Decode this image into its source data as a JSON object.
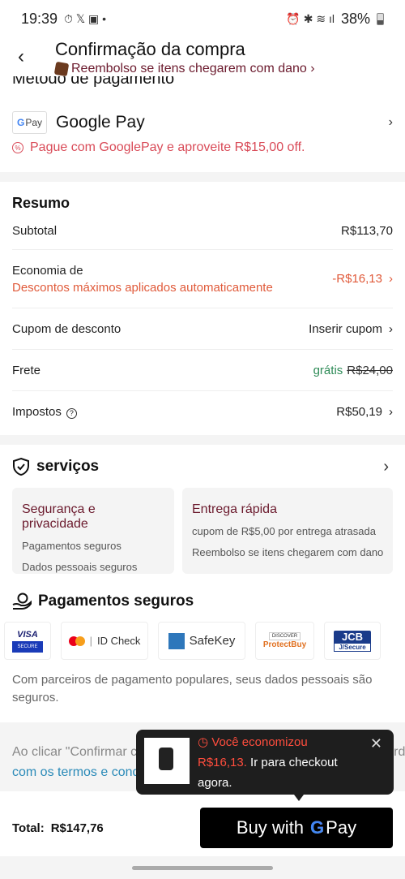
{
  "status_bar": {
    "time": "19:39",
    "battery": "38%",
    "battery_level": 0.38
  },
  "header": {
    "title": "Confirmação da compra",
    "subtitle": "Reembolso se itens chegarem com dano ›"
  },
  "payment_method": {
    "section_title": "Método de pagamento",
    "logo_text": "Pay",
    "name": "Google Pay",
    "promo": "Pague com GooglePay e aproveite R$15,00 off."
  },
  "summary": {
    "title": "Resumo",
    "subtotal_label": "Subtotal",
    "subtotal_value": "R$113,70",
    "savings_label": "Economia de",
    "savings_note": "Descontos máximos aplicados automaticamente",
    "savings_value": "-R$16,13",
    "coupon_label": "Cupom de desconto",
    "coupon_value": "Inserir cupom",
    "shipping_label": "Frete",
    "shipping_free": "grátis",
    "shipping_original": "R$24,00",
    "taxes_label": "Impostos",
    "taxes_value": "R$50,19"
  },
  "services": {
    "title": "serviços",
    "cards": [
      {
        "title": "Segurança e privacidade",
        "lines": [
          "Pagamentos seguros",
          "Dados pessoais seguros"
        ]
      },
      {
        "title": "Entrega rápida",
        "lines": [
          "cupom de R$5,00 por entrega atrasada",
          "Reembolso se itens chegarem com dano"
        ]
      }
    ]
  },
  "secure_payments": {
    "title": "Pagamentos seguros",
    "logos": [
      "VISA SECURE",
      "ID Check",
      "SafeKey",
      "ProtectBuy",
      "JCB J/Secure"
    ],
    "note": "Com parceiros de pagamento populares, seus dados pessoais são seguros."
  },
  "terms": {
    "line1": "Ao clicar \"Confirmar compra\", você confirma que leu e está de acordo",
    "line2": "com os termos e condições de uso"
  },
  "tooltip": {
    "title": "Você economizou",
    "amount": "R$16,13.",
    "text": " Ir para checkout",
    "text2": "agora."
  },
  "footer": {
    "total_label": "Total:",
    "total_value": "R$147,76",
    "buy_label": "Buy with",
    "buy_pay": "Pay"
  },
  "colors": {
    "accent_red": "#e05a3a",
    "brand_maroon": "#6b1a2d",
    "free_green": "#2e8b57",
    "link_blue": "#2a8ab8"
  }
}
